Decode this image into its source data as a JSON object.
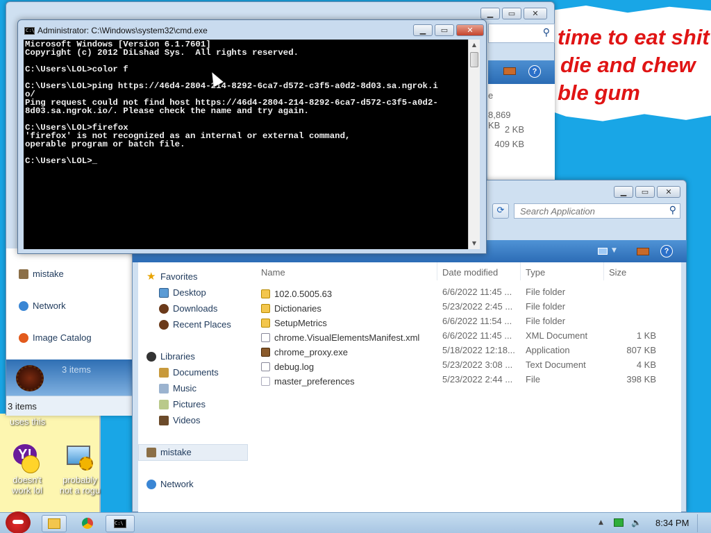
{
  "wallpaper": {
    "meme_lines": [
      "time to eat shit",
      "die and chew",
      "ble gum"
    ],
    "note_text": "uses this"
  },
  "desktop_icons": [
    {
      "label_lines": [
        "doesn't",
        "work lol"
      ],
      "icon": "yahoo-messenger-icon"
    },
    {
      "label_lines": [
        "probably",
        "not a rogu"
      ],
      "icon": "monitor-gears-icon"
    }
  ],
  "cmd": {
    "title": "Administrator: C:\\Windows\\system32\\cmd.exe",
    "lines": [
      "Microsoft Windows [Version 6.1.7601]",
      "Copyright (c) 2012 DiLshad Sys.  All rights reserved.",
      "",
      "C:\\Users\\LOL>color f",
      "",
      "C:\\Users\\LOL>ping https://46d4-2804-214-8292-6ca7-d572-c3f5-a0d2-8d03.sa.ngrok.i",
      "o/",
      "Ping request could not find host https://46d4-2804-214-8292-6ca7-d572-c3f5-a0d2-",
      "8d03.sa.ngrok.io/. Please check the name and try again.",
      "",
      "C:\\Users\\LOL>firefox",
      "'firefox' is not recognized as an internal or external command,",
      "operable program or batch file.",
      "",
      "C:\\Users\\LOL>_"
    ]
  },
  "back_explorer": {
    "sizes": [
      "8,869 KB",
      "2 KB",
      "409 KB"
    ],
    "col_header_partial": "e",
    "nav": [
      "mistake",
      "Network",
      "Image Catalog"
    ],
    "selected_label": "3 items",
    "status": "3 items"
  },
  "explorer": {
    "search_placeholder": "Search Application",
    "columns": {
      "name": "Name",
      "date": "Date modified",
      "type": "Type",
      "size": "Size"
    },
    "favorites": {
      "title": "Favorites",
      "items": [
        "Desktop",
        "Downloads",
        "Recent Places"
      ]
    },
    "libraries": {
      "title": "Libraries",
      "items": [
        "Documents",
        "Music",
        "Pictures",
        "Videos"
      ]
    },
    "mistake": "mistake",
    "network": "Network",
    "files": [
      {
        "name": "102.0.5005.63",
        "date": "6/6/2022 11:45 ...",
        "type": "File folder",
        "size": "",
        "icon": "folder-icon"
      },
      {
        "name": "Dictionaries",
        "date": "5/23/2022 2:45 ...",
        "type": "File folder",
        "size": "",
        "icon": "folder-icon"
      },
      {
        "name": "SetupMetrics",
        "date": "6/6/2022 11:54 ...",
        "type": "File folder",
        "size": "",
        "icon": "folder-icon"
      },
      {
        "name": "chrome.VisualElementsManifest.xml",
        "date": "6/6/2022 11:45 ...",
        "type": "XML Document",
        "size": "1 KB",
        "icon": "xml-file-icon"
      },
      {
        "name": "chrome_proxy.exe",
        "date": "5/18/2022 12:18...",
        "type": "Application",
        "size": "807 KB",
        "icon": "exe-file-icon"
      },
      {
        "name": "debug.log",
        "date": "5/23/2022 3:08 ...",
        "type": "Text Document",
        "size": "4 KB",
        "icon": "text-file-icon"
      },
      {
        "name": "master_preferences",
        "date": "5/23/2022 2:44 ...",
        "type": "File",
        "size": "398 KB",
        "icon": "file-icon"
      }
    ]
  },
  "taskbar": {
    "clock": "8:34 PM",
    "buttons": [
      "explorer-icon",
      "chrome-icon",
      "cmd-icon"
    ]
  },
  "colors": {
    "desktop": "#19a6e6",
    "meme_text": "#e01414",
    "console_bg": "#000000",
    "console_fg": "#f0f0f0"
  }
}
